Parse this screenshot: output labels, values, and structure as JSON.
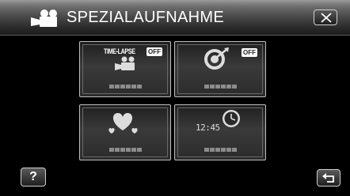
{
  "header": {
    "title": "SPEZIALAUFNAHME",
    "mode_icon": "movie-camera-icon",
    "close_icon": "close-icon"
  },
  "tiles": [
    {
      "label": "TIME-LAPSE",
      "badge": "OFF",
      "icon": "time-lapse-camera-icon"
    },
    {
      "badge": "OFF",
      "icon": "auto-rec-target-icon"
    },
    {
      "icon": "heart-effect-icon"
    },
    {
      "clock": "12:45",
      "icon": "date-time-clock-icon"
    }
  ],
  "footer": {
    "help_label": "?",
    "back_icon": "return-arrow-icon"
  },
  "colors": {
    "header_top": "#9a9a9a",
    "header_bottom": "#1c1c1c",
    "tile_border": "#bdbdbd",
    "background": "#000000"
  }
}
